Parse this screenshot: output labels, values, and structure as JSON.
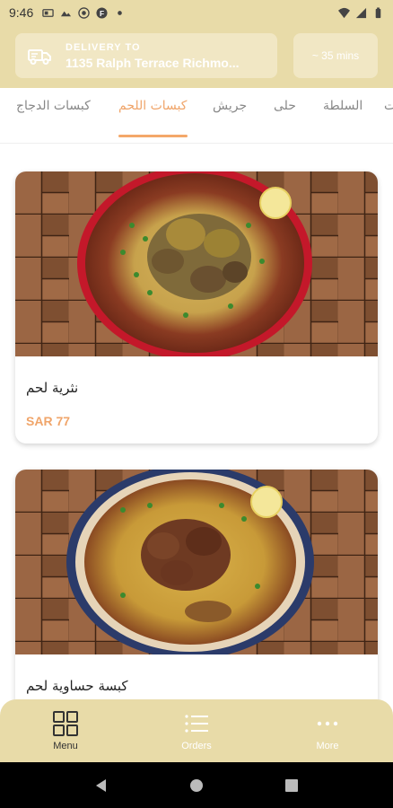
{
  "status_bar": {
    "time": "9:46",
    "icons_left": [
      "sim-icon",
      "photo-icon",
      "record-icon",
      "app-f-icon",
      "dot-icon"
    ],
    "icons_right": [
      "wifi-icon",
      "signal-icon",
      "battery-icon"
    ]
  },
  "header": {
    "delivery_label": "DELIVERY TO",
    "delivery_address": "1135 Ralph Terrace Richmo...",
    "eta": "~ 35 mins"
  },
  "categories": {
    "tabs": [
      {
        "label": "كبسات الدجاج",
        "active": false
      },
      {
        "label": "كبسات اللحم",
        "active": true
      },
      {
        "label": "جريش",
        "active": false
      },
      {
        "label": "حلى",
        "active": false
      },
      {
        "label": "السلطة",
        "active": false
      },
      {
        "label": "ت",
        "active": false
      }
    ]
  },
  "products": [
    {
      "name": "نثرية لحم",
      "price": "SAR 77"
    },
    {
      "name": "كبسة حساوية لحم",
      "price": ""
    }
  ],
  "bottom_nav": {
    "items": [
      {
        "label": "Menu",
        "icon": "grid-icon",
        "active": true
      },
      {
        "label": "Orders",
        "icon": "list-icon",
        "active": false
      },
      {
        "label": "More",
        "icon": "more-icon",
        "active": false
      }
    ]
  },
  "colors": {
    "header_bg": "#e8dba8",
    "accent": "#f0a56a",
    "nav_active": "#333333"
  }
}
